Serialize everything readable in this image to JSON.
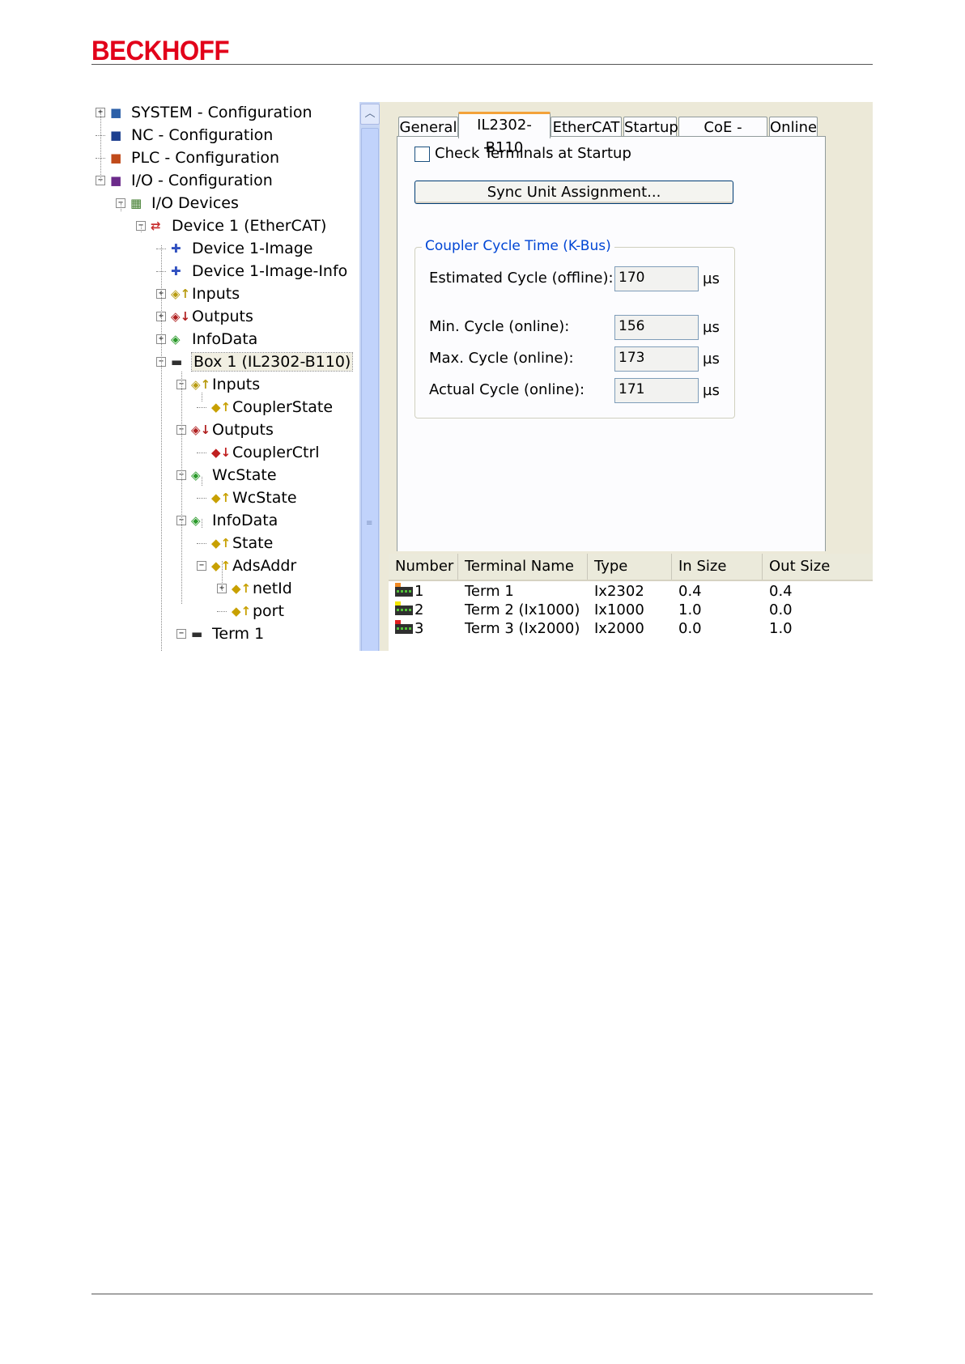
{
  "header": {
    "logo_text": "BECKHOFF",
    "brand_color": "#e2001a"
  },
  "tree": {
    "items": [
      {
        "label": "SYSTEM - Configuration",
        "icon": "system-config-icon",
        "expander": "+",
        "level": 0
      },
      {
        "label": "NC - Configuration",
        "icon": "nc-config-icon",
        "expander": "",
        "level": 0
      },
      {
        "label": "PLC - Configuration",
        "icon": "plc-config-icon",
        "expander": "",
        "level": 0
      },
      {
        "label": "I/O - Configuration",
        "icon": "io-config-icon",
        "expander": "−",
        "level": 0
      },
      {
        "label": "I/O Devices",
        "icon": "io-devices-icon",
        "expander": "−",
        "level": 1
      },
      {
        "label": "Device 1 (EtherCAT)",
        "icon": "ethercat-device-icon",
        "expander": "−",
        "level": 2
      },
      {
        "label": "Device 1-Image",
        "icon": "image-icon",
        "expander": "",
        "level": 3
      },
      {
        "label": "Device 1-Image-Info",
        "icon": "image-info-icon",
        "expander": "",
        "level": 3
      },
      {
        "label": "Inputs",
        "icon": "inputs-icon",
        "expander": "+",
        "level": 3
      },
      {
        "label": "Outputs",
        "icon": "outputs-icon",
        "expander": "+",
        "level": 3
      },
      {
        "label": "InfoData",
        "icon": "infodata-icon",
        "expander": "+",
        "level": 3
      },
      {
        "label": "Box 1 (IL2302-B110)",
        "icon": "box-icon",
        "expander": "−",
        "level": 3,
        "selected": true
      },
      {
        "label": "Inputs",
        "icon": "inputs-icon",
        "expander": "−",
        "level": 4
      },
      {
        "label": "CouplerState",
        "icon": "input-var-icon",
        "expander": "",
        "level": 5
      },
      {
        "label": "Outputs",
        "icon": "outputs-icon",
        "expander": "−",
        "level": 4
      },
      {
        "label": "CouplerCtrl",
        "icon": "output-var-icon",
        "expander": "",
        "level": 5
      },
      {
        "label": "WcState",
        "icon": "wcstate-icon",
        "expander": "−",
        "level": 4
      },
      {
        "label": "WcState",
        "icon": "input-var-icon",
        "expander": "",
        "level": 5
      },
      {
        "label": "InfoData",
        "icon": "infodata-icon",
        "expander": "−",
        "level": 4
      },
      {
        "label": "State",
        "icon": "input-var-icon",
        "expander": "",
        "level": 5
      },
      {
        "label": "AdsAddr",
        "icon": "adsaddr-icon",
        "expander": "−",
        "level": 5
      },
      {
        "label": "netId",
        "icon": "netid-icon",
        "expander": "+",
        "level": 6
      },
      {
        "label": "port",
        "icon": "input-var-icon",
        "expander": "",
        "level": 6
      },
      {
        "label": "Term 1",
        "icon": "terminal-icon",
        "expander": "−",
        "level": 4
      }
    ]
  },
  "tabs": [
    {
      "label": "General"
    },
    {
      "label": "IL2302-B110",
      "active": true
    },
    {
      "label": "EtherCAT"
    },
    {
      "label": "Startup"
    },
    {
      "label": "CoE - Online"
    },
    {
      "label": "Online"
    }
  ],
  "settings": {
    "check_terminals_label": "Check Terminals at Startup",
    "check_terminals_checked": false,
    "sync_button_label": "Sync Unit Assignment...",
    "group_title": "Coupler Cycle Time (K-Bus)",
    "fields": [
      {
        "label": "Estimated Cycle (offline):",
        "value": "170",
        "unit": "µs"
      },
      {
        "label": "Min. Cycle (online):",
        "value": "156",
        "unit": "µs"
      },
      {
        "label": "Max. Cycle (online):",
        "value": "173",
        "unit": "µs"
      },
      {
        "label": "Actual Cycle (online):",
        "value": "171",
        "unit": "µs"
      }
    ]
  },
  "terminal_table": {
    "headers": [
      "Number",
      "Terminal Name",
      "Type",
      "In Size",
      "Out Size"
    ],
    "rows": [
      {
        "number": "1",
        "name": "Term 1",
        "type": "Ix2302",
        "in": "0.4",
        "out": "0.4",
        "flag_color": "#f08a24"
      },
      {
        "number": "2",
        "name": "Term 2 (Ix1000)",
        "type": "Ix1000",
        "in": "1.0",
        "out": "0.0",
        "flag_color": "#f2e600"
      },
      {
        "number": "3",
        "name": "Term 3 (Ix2000)",
        "type": "Ix2000",
        "in": "0.0",
        "out": "1.0",
        "flag_color": "#e02020"
      }
    ]
  }
}
